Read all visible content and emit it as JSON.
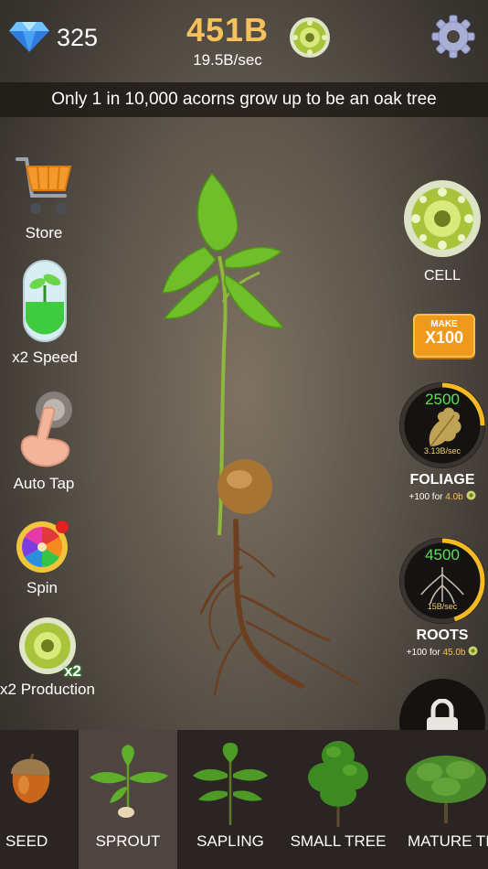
{
  "header": {
    "gems": "325",
    "score": "451B",
    "rate": "19.5B/sec"
  },
  "banner": "Only 1 in 10,000 acorns grow up to be an oak tree",
  "left_menu": {
    "store": "Store",
    "speed": "x2 Speed",
    "autotap": "Auto Tap",
    "spin": "Spin",
    "production": "x2 Production",
    "production_badge": "x2"
  },
  "right_panel": {
    "cell": "CELL",
    "make_line1": "MAKE",
    "make_line2": "X100",
    "foliage": {
      "count": "2500",
      "rate": "3.13B/sec",
      "name": "FOLIAGE",
      "upgrade_prefix": "+100 for ",
      "upgrade_cost": "4.0b",
      "progress": 0.25
    },
    "roots": {
      "count": "4500",
      "rate": "15B/sec",
      "name": "ROOTS",
      "upgrade_prefix": "+100 for ",
      "upgrade_cost": "45.0b",
      "progress": 0.45
    }
  },
  "stages": [
    {
      "label": "SEED",
      "selected": false
    },
    {
      "label": "SPROUT",
      "selected": true
    },
    {
      "label": "SAPLING",
      "selected": false
    },
    {
      "label": "SMALL TREE",
      "selected": false
    },
    {
      "label": "MATURE TRE",
      "selected": false
    }
  ],
  "colors": {
    "score": "#f6c15a",
    "generator_count": "#55e255",
    "progress_ring": "#f5b921",
    "selected_stage": "#4e4540"
  }
}
